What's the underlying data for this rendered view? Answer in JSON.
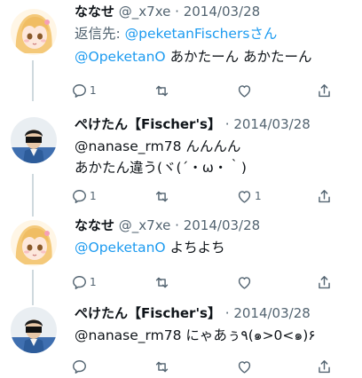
{
  "tweets": [
    {
      "display_name": "ななせ",
      "handle": "@_x7xe",
      "sep": "·",
      "date": "2014/03/28",
      "reply_prefix": "返信先: ",
      "reply_mention": "@peketanFischersさん",
      "mention": "@OpeketanO",
      "text": " あかたーん あかたーん",
      "reply_count": "1",
      "like_count": "",
      "avatar_icon": "anime-girl-avatar"
    },
    {
      "display_name": "ぺけたん【Fischer's】",
      "handle": "",
      "sep": "·",
      "date": "2014/03/28",
      "line1": "@nanase_rm78 んんんん",
      "line2": "あかたん違う(ヾ(´・ω・｀)",
      "reply_count": "1",
      "like_count": "1",
      "avatar_icon": "person-photo-avatar"
    },
    {
      "display_name": "ななせ",
      "handle": "@_x7xe",
      "sep": "·",
      "date": "2014/03/28",
      "mention": "@OpeketanO",
      "text": " よちよち",
      "reply_count": "1",
      "like_count": "",
      "avatar_icon": "anime-girl-avatar"
    },
    {
      "display_name": "ぺけたん【Fischer's】",
      "handle": "",
      "sep": "·",
      "date": "2014/03/28",
      "line1": "@nanase_rm78 にゃあぅ٩(๑>0<๑)۶",
      "reply_count": "",
      "like_count": "",
      "avatar_icon": "person-photo-avatar"
    }
  ],
  "colors": {
    "accent": "#1d9bf0",
    "muted": "#536471",
    "thread_line": "#cfd9de"
  },
  "icons": {
    "reply": "reply-icon",
    "retweet": "retweet-icon",
    "like": "heart-icon",
    "share": "share-icon"
  }
}
